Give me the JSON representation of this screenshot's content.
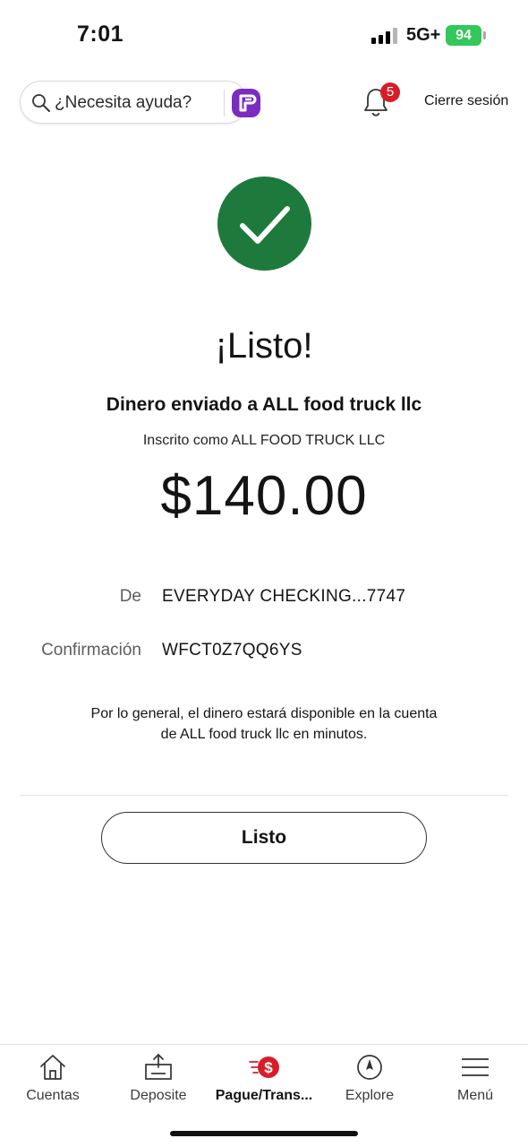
{
  "status_bar": {
    "time": "7:01",
    "network": "5G+",
    "battery": "94"
  },
  "header": {
    "help_label": "¿Necesita ayuda?",
    "notification_count": "5",
    "logout_label": "Cierre sesión"
  },
  "confirmation": {
    "title": "¡Listo!",
    "subtitle": "Dinero enviado a ALL food truck llc",
    "enrolled_as": "Inscrito como ALL FOOD TRUCK LLC",
    "amount": "$140.00",
    "from_label": "De",
    "from_value": "EVERYDAY CHECKING...7747",
    "confirmation_label": "Confirmación",
    "confirmation_value": "WFCT0Z7QQ6YS",
    "note": "Por lo general, el dinero estará disponible en la cuenta de ALL food truck llc en minutos.",
    "done_label": "Listo"
  },
  "bottom_nav": {
    "items": [
      {
        "label": "Cuentas",
        "icon": "home-icon"
      },
      {
        "label": "Deposite",
        "icon": "deposit-icon"
      },
      {
        "label": "Pague/Trans...",
        "icon": "pay-transfer-icon",
        "active": true
      },
      {
        "label": "Explore",
        "icon": "compass-icon"
      },
      {
        "label": "Menú",
        "icon": "menu-icon"
      }
    ]
  },
  "colors": {
    "success_green": "#1e7a3c",
    "badge_red": "#d71e28",
    "assistant_purple": "#7b2bbf",
    "battery_green": "#34c759"
  }
}
